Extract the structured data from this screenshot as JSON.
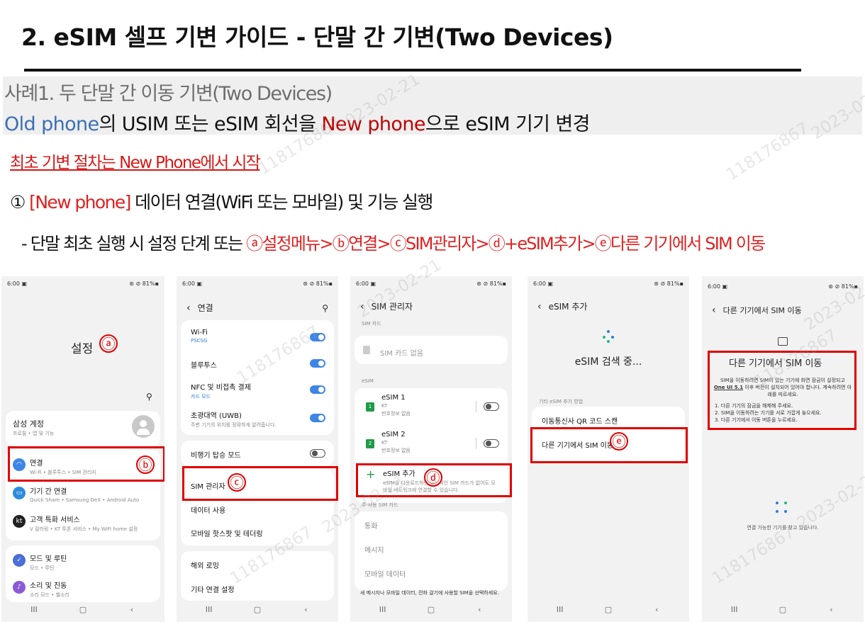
{
  "title": "2. eSIM 셀프 기변 가이드 - 단말 간 기변(Two Devices)",
  "case": {
    "heading": "사례1. 두 단말 간 이동 기변(Two Devices)",
    "desc_old": "Old phone",
    "desc_mid": "의 USIM 또는 eSIM 회선을 ",
    "desc_new": "New phone",
    "desc_end": "으로 eSIM 기기 변경"
  },
  "start_note": {
    "prefix": "최초 기변 절차는 ",
    "emph": "New Phone",
    "suffix": "에서 시작"
  },
  "step1": {
    "num": "①",
    "tag": "[New phone]",
    "text": " 데이터 연결(WiFi 또는 모바일) 및 기능 실행"
  },
  "path": {
    "prefix": "- 단말 최초 실행 시 설정 단계 또는 ",
    "steps": "ⓐ설정메뉴>ⓑ연결>ⓒSIM관리자>ⓓ+eSIM추가>ⓔ다른 기기에서 SIM 이동"
  },
  "watermark": {
    "id": "118176867",
    "date": "2023-02-21"
  },
  "status": {
    "time": "6:00 ▣",
    "right": "⊛ ⊘ 81%▪"
  },
  "markers": {
    "a": "ⓐ",
    "b": "ⓑ",
    "c": "ⓒ",
    "d": "ⓓ",
    "e": "ⓔ"
  },
  "nav": {
    "recent": "III",
    "home": "▢",
    "back": "‹"
  },
  "screen1": {
    "title": "설정",
    "account": {
      "title": "삼성 계정",
      "sub": "프로필 • 앱 및 기능"
    },
    "items": [
      {
        "title": "연결",
        "sub": "Wi-Fi • 블루투스 • SIM 관리자",
        "icon": "wifi-icon"
      },
      {
        "title": "기기 간 연결",
        "sub": "Quick Share • Samsung DeX • Android Auto",
        "icon": "devices-icon"
      },
      {
        "title": "고객 특화 서비스",
        "sub": "V 컬러링 • KT 투폰 서비스 • My WiFi home 설정",
        "icon": "kt-icon"
      },
      {
        "title": "모드 및 루틴",
        "sub": "모드 • 루틴",
        "icon": "check-icon"
      },
      {
        "title": "소리 및 진동",
        "sub": "소리 모드 • 벨소리",
        "icon": "sound-icon"
      }
    ]
  },
  "screen2": {
    "title": "연결",
    "wifi": {
      "title": "Wi-Fi",
      "sub": "PSCSG"
    },
    "bluetooth": "블루투스",
    "nfc": {
      "title": "NFC 및 비접촉 결제",
      "sub": "카드 모드"
    },
    "uwb": {
      "title": "초광대역 (UWB)",
      "sub": "주변 기기의 위치를 정확하게 알려줍니다."
    },
    "airplane": "비행기 탑승 모드",
    "sim_manager": "SIM 관리자",
    "data_usage": "데이터 사용",
    "hotspot": "모바일 핫스팟 및 테더링",
    "roaming": "해외 로밍",
    "more": "기타 연결 설정"
  },
  "screen3": {
    "title": "SIM 관리자",
    "sim_card_label": "SIM 카드",
    "no_sim": "SIM 카드 없음",
    "esim_label": "eSIM",
    "esim1": {
      "title": "eSIM 1",
      "carrier": "KT",
      "sub": "번호정보 없음"
    },
    "esim2": {
      "title": "eSIM 2",
      "carrier": "KT",
      "sub": "번호정보 없음"
    },
    "add": {
      "title": "eSIM 추가",
      "sub": "eSIM을 다운로드하면 물리적인 SIM 카드가 없어도 모바일 네트워크에 연결할 수 있습니다."
    },
    "primary_label": "주 사용 SIM 카드",
    "calls": "통화",
    "messages": "메시지",
    "mobile_data": "모바일 데이터",
    "footer": "새 메시지나 모바일 데이터, 전화 걸기에 사용할 SIM을 선택하세요."
  },
  "screen4": {
    "title": "eSIM 추가",
    "searching": "eSIM 검색 중...",
    "other_label": "기타 eSIM 추가 방법",
    "qr": "이동통신사 QR 코드 스캔",
    "transfer": "다른 기기에서 SIM 이동"
  },
  "screen5": {
    "title": "다른 기기에서 SIM 이동",
    "heading": "다른 기기에서 SIM 이동",
    "body1": "SIM을 이동하려면 SIM이 있는 기기에 화면 잠금이 설정되고",
    "body2_link": "One UI 5.1",
    "body2": " 이후 버전이 설치되어 있어야 합니다. 계속하려면 아래를 따르세요.",
    "list": [
      "1. 다른 기기의 잠금을 해제해 주세요.",
      "2. SIM을 이동하려는 기기를 서로 가깝게 놓으세요.",
      "3. 다른 기기에서 이동 버튼을 누르세요."
    ],
    "looking": "연결 가능한 기기를 찾고 있습니다."
  }
}
